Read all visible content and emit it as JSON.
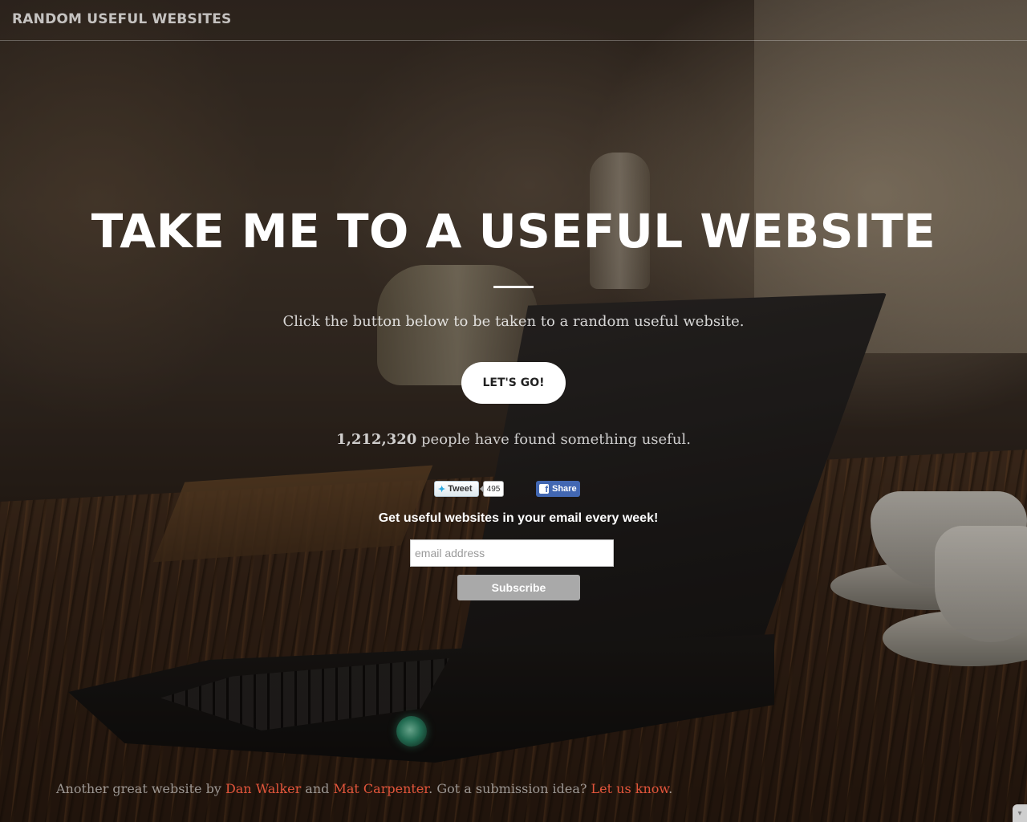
{
  "nav": {
    "brand": "RANDOM USEFUL WEBSITES"
  },
  "hero": {
    "headline": "TAKE ME TO A USEFUL WEBSITE",
    "subtitle": "Click the button below to be taken to a random useful website.",
    "button_label": "LET'S GO!",
    "count": "1,212,320",
    "count_suffix": " people have found something useful."
  },
  "social": {
    "tweet_label": "Tweet",
    "tweet_count": "495",
    "share_label": "Share",
    "twitter_icon": "twitter-bird-icon",
    "facebook_icon": "facebook-f-icon"
  },
  "newsletter": {
    "heading": "Get useful websites in your email every week!",
    "email_placeholder": "email address",
    "email_value": "",
    "subscribe_label": "Subscribe"
  },
  "footer": {
    "prefix": "Another great website by ",
    "author1": "Dan Walker",
    "and": " and ",
    "author2": "Mat Carpenter",
    "middle": ". Got a submission idea? ",
    "link": "Let us know",
    "suffix": ".",
    "link_color": "#e2553b"
  }
}
